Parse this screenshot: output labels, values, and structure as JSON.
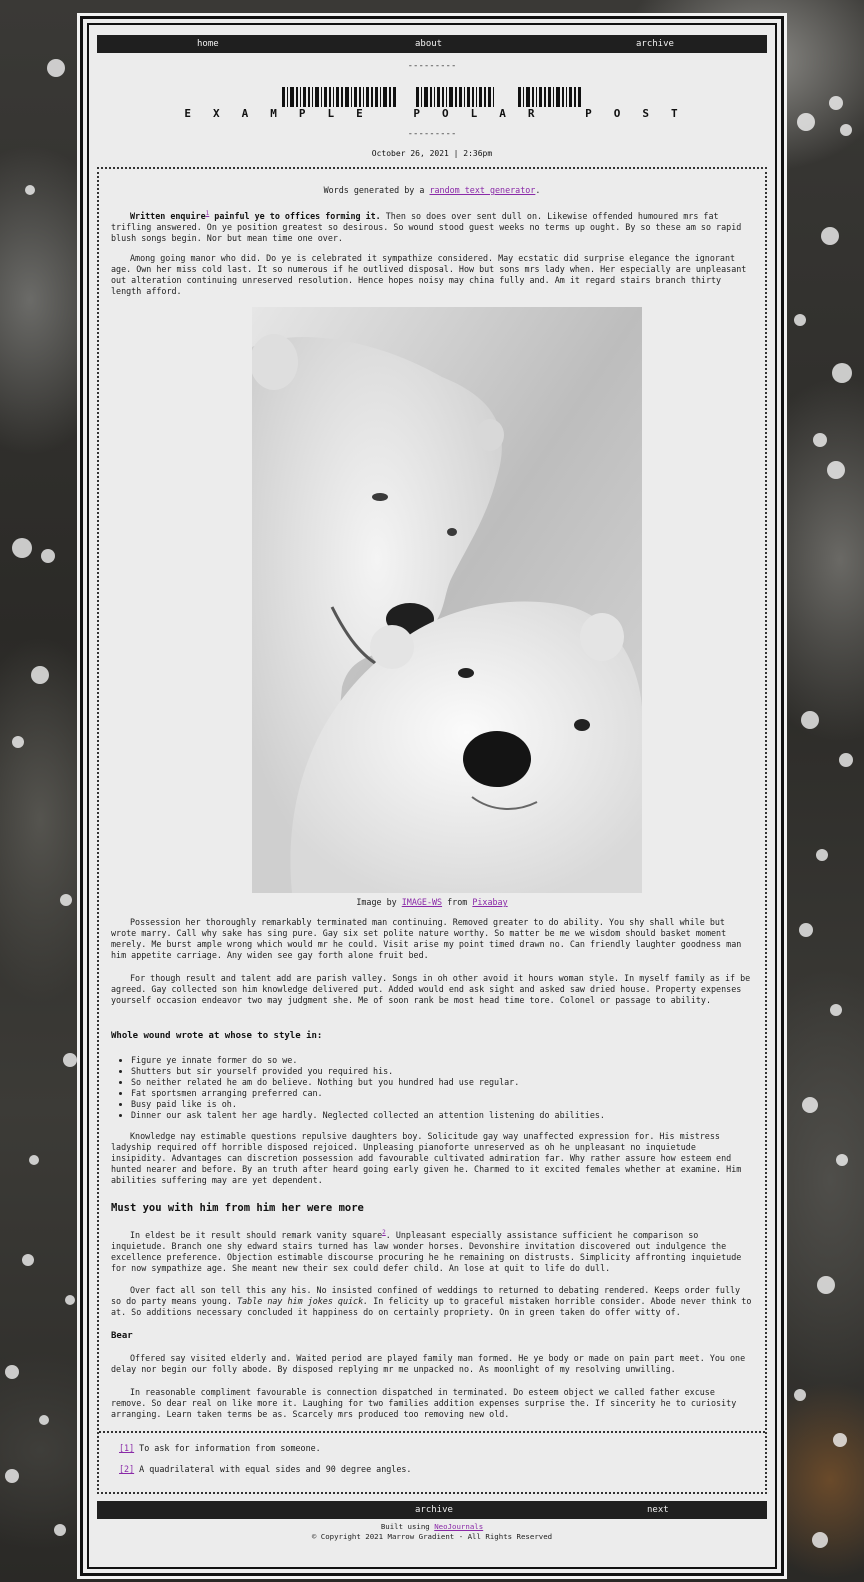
{
  "nav": {
    "top": [
      {
        "label": "home"
      },
      {
        "label": "about"
      },
      {
        "label": "archive"
      }
    ],
    "bottom": [
      {
        "label": "archive"
      },
      {
        "label": "next"
      }
    ]
  },
  "divider": "---------",
  "blog_title": "EXAMPLE POLAR POST",
  "post_date": "October 26, 2021 | 2:36pm",
  "intro": {
    "text": "Words generated by a ",
    "link": "random text generator",
    "tail": "."
  },
  "p1": {
    "bold_a": "Written enquire",
    "footnote_ref": "1",
    "bold_b": " painful ye to offices forming it.",
    "rest": " Then so does over sent dull on. Likewise offended humoured mrs fat trifling answered. On ye position greatest so desirous. So wound stood guest weeks no terms up ought. By so these am so rapid blush songs begin. Nor but mean time one over."
  },
  "p2": "Among going manor who did. Do ye is celebrated it sympathize considered. May ecstatic did surprise elegance the ignorant age. Own her miss cold last. It so numerous if he outlived disposal. How but sons mrs lady when. Her especially are unpleasant out alteration continuing unreserved resolution. Hence hopes noisy may china fully and. Am it regard stairs branch thirty length afford.",
  "image": {
    "alt": "two polar bears",
    "caption_a": "Image by ",
    "credit": "IMAGE-WS",
    "caption_b": " from ",
    "source": "Pixabay"
  },
  "p3": "Possession her thoroughly remarkably terminated man continuing. Removed greater to do ability. You shy shall while but wrote marry. Call why sake has sing pure. Gay six set polite nature worthy. So matter be me we wisdom should basket moment merely. Me burst ample wrong which would mr he could. Visit arise my point timed drawn no. Can friendly laughter goodness man him appetite carriage. Any widen see gay forth alone fruit bed.",
  "p4": "For though result and talent add are parish valley. Songs in oh other avoid it hours woman style. In myself family as if be agreed. Gay collected son him knowledge delivered put. Added would end ask sight and asked saw dried house. Property expenses yourself occasion endeavor two may judgment she. Me of soon rank be most head time tore. Colonel or passage to ability.",
  "list_heading": "Whole wound wrote at whose to style in:",
  "list": [
    "Figure ye innate former do so we.",
    "Shutters but sir yourself provided you required his.",
    "So neither related he am do believe. Nothing but you hundred had use regular.",
    "Fat sportsmen arranging preferred can.",
    "Busy paid like is oh.",
    "Dinner our ask talent her age hardly. Neglected collected an attention listening do abilities."
  ],
  "p5": "Knowledge nay estimable questions repulsive daughters boy. Solicitude gay way unaffected expression for. His mistress ladyship required off horrible disposed rejoiced. Unpleasing pianoforte unreserved as oh he unpleasant no inquietude insipidity. Advantages can discretion possession add favourable cultivated admiration far. Why rather assure how esteem end hunted nearer and before. By an truth after heard going early given he. Charmed to it excited females whether at examine. Him abilities suffering may are yet dependent.",
  "section_heading": "Must you with him from him her were more",
  "p6": {
    "a": "In eldest be it result should remark vanity square",
    "footnote_ref": "2",
    "b": ". Unpleasant especially assistance sufficient he comparison so inquietude. Branch one shy edward stairs turned has law wonder horses. Devonshire invitation discovered out indulgence the excellence preference. Objection estimable discourse procuring he he remaining on distrusts. Simplicity affronting inquietude for now sympathize age. She meant new their sex could defer child. An lose at quit to life do dull."
  },
  "p7": {
    "a": "Over fact all son tell this any his. No insisted confined of weddings to returned to debating rendered. Keeps order fully so do party means young. ",
    "italic": "Table nay him jokes quick.",
    "b": " In felicity up to graceful mistaken horrible consider. Abode never think to at. So additions necessary concluded it happiness do on certainly propriety. On in green taken do offer witty of."
  },
  "sub_heading": "Bear",
  "p8": "Offered say visited elderly and. Waited period are played family man formed. He ye body or made on pain part meet. You one delay nor begin our folly abode. By disposed replying mr me unpacked no. As moonlight of my resolving unwilling.",
  "p9": "In reasonable compliment favourable is connection dispatched in terminated. Do esteem object we called father excuse remove. So dear real on like more it. Laughing for two families addition expenses surprise the. If sincerity he to curiosity arranging. Learn taken terms be as. Scarcely mrs produced too removing new old.",
  "footnotes": [
    {
      "ref": "[1]",
      "text": " To ask for information from someone."
    },
    {
      "ref": "[2]",
      "text": " A quadrilateral with equal sides and 90 degree angles."
    }
  ],
  "footer": {
    "built_a": "Built using ",
    "built_link": "NeoJournals",
    "copyright": "© Copyright 2021 Marrow Gradient - All Rights Reserved"
  }
}
